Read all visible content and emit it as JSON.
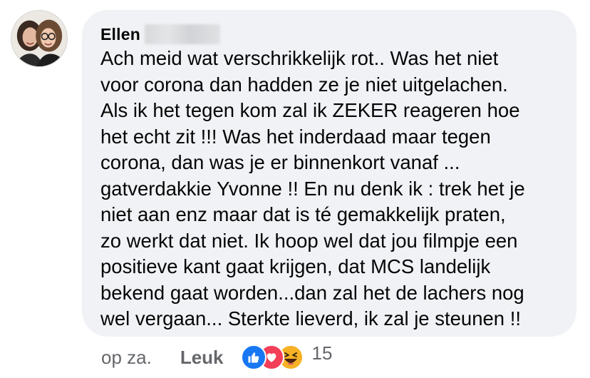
{
  "comment": {
    "author": {
      "first_name": "Ellen",
      "avatar_icon": "profile-photo"
    },
    "text": "Ach meid wat verschrikkelijk rot.. Was het niet\nvoor corona dan hadden ze  je niet uitgelachen.\nAls ik het tegen kom zal ik ZEKER reageren hoe\nhet echt zit !!!  Was het inderdaad maar tegen\ncorona, dan was je er binnenkort vanaf ...\ngatverdakkie Yvonne !! En nu denk ik : trek het je\nniet aan enz maar dat is té gemakkelijk praten,\nzo werkt dat niet. Ik hoop wel dat jou filmpje een\npositieve kant gaat krijgen, dat MCS landelijk\nbekend gaat worden...dan zal het de lachers nog\nwel vergaan... Sterkte lieverd, ik zal je steunen !!",
    "timestamp": "op za.",
    "like_label": "Leuk",
    "reactions": {
      "icons": [
        "like-icon",
        "love-icon",
        "haha-icon"
      ],
      "count": "15"
    }
  },
  "colors": {
    "bubble_bg": "#f0f2f5",
    "text": "#050505",
    "secondary_text": "#65676b",
    "like_blue": "#1877f2",
    "love_red": "#f33e58",
    "haha_yellow": "#f7b125"
  }
}
